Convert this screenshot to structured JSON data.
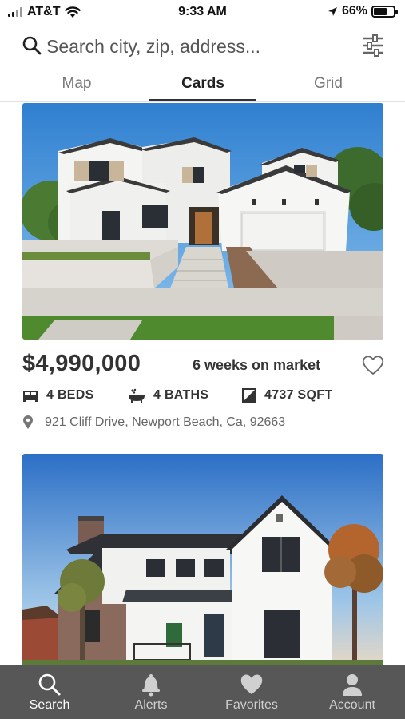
{
  "status_bar": {
    "carrier": "AT&T",
    "time": "9:33 AM",
    "battery": "66%",
    "battery_level": 0.66
  },
  "search": {
    "placeholder": "Search city, zip, address..."
  },
  "tabs": [
    {
      "label": "Map",
      "active": false
    },
    {
      "label": "Cards",
      "active": true
    },
    {
      "label": "Grid",
      "active": false
    }
  ],
  "listing": {
    "price": "$4,990,000",
    "market_time": "6 weeks on market",
    "beds": "4 BEDS",
    "baths": "4 BATHS",
    "sqft": "4737 SQFT",
    "address": "921 Cliff Drive, Newport Beach, Ca, 92663"
  },
  "bottom_nav": [
    {
      "label": "Search",
      "icon": "search-icon",
      "active": true
    },
    {
      "label": "Alerts",
      "icon": "bell-icon",
      "active": false
    },
    {
      "label": "Favorites",
      "icon": "heart-icon",
      "active": false
    },
    {
      "label": "Account",
      "icon": "person-icon",
      "active": false
    }
  ],
  "colors": {
    "nav_background": "#575757",
    "text_primary": "#333333",
    "text_secondary": "#666666",
    "sky": "#3f8fd6"
  }
}
